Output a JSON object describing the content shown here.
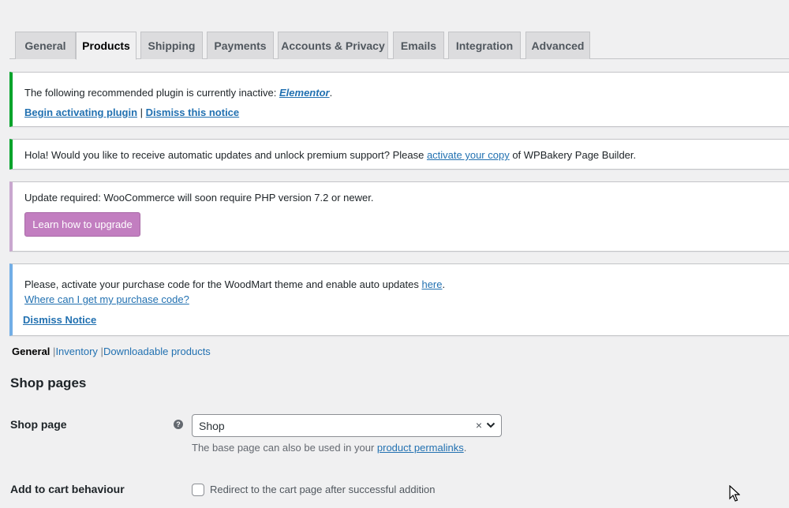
{
  "tabs": [
    {
      "label": "General",
      "active": false
    },
    {
      "label": "Products",
      "active": true
    },
    {
      "label": "Shipping",
      "active": false
    },
    {
      "label": "Payments",
      "active": false
    },
    {
      "label": "Accounts & Privacy",
      "active": false
    },
    {
      "label": "Emails",
      "active": false
    },
    {
      "label": "Integration",
      "active": false
    },
    {
      "label": "Advanced",
      "active": false
    }
  ],
  "notices": {
    "elementor": {
      "text": "The following recommended plugin is currently inactive: ",
      "plugin_link": "Elementor",
      "suffix": ".",
      "activate_link": "Begin activating plugin",
      "separator": "|",
      "dismiss_link": "Dismiss this notice"
    },
    "wpbakery": {
      "text_before": "Hola! Would you like to receive automatic updates and unlock premium support? Please ",
      "link": "activate your copy",
      "text_after": " of WPBakery Page Builder."
    },
    "php": {
      "text": "Update required: WooCommerce will soon require PHP version 7.2 or newer.",
      "button": "Learn how to upgrade"
    },
    "woodmart": {
      "text_before": "Please, activate your purchase code for the WoodMart theme and enable auto updates ",
      "here_link": "here",
      "suffix": ".",
      "purchase_link": "Where can I get my purchase code?",
      "dismiss_link": "Dismiss Notice"
    }
  },
  "subnav": {
    "current": "General",
    "sep": "|",
    "inventory": "Inventory",
    "downloadable": "Downloadable products"
  },
  "section_title": "Shop pages",
  "shop_page": {
    "label": "Shop page",
    "help": "?",
    "value": "Shop",
    "clear": "×",
    "desc_before": "The base page can also be used in your ",
    "desc_link": "product permalinks",
    "desc_after": "."
  },
  "add_to_cart": {
    "label": "Add to cart behaviour",
    "checkbox_label": "Redirect to the cart page after successful addition"
  }
}
